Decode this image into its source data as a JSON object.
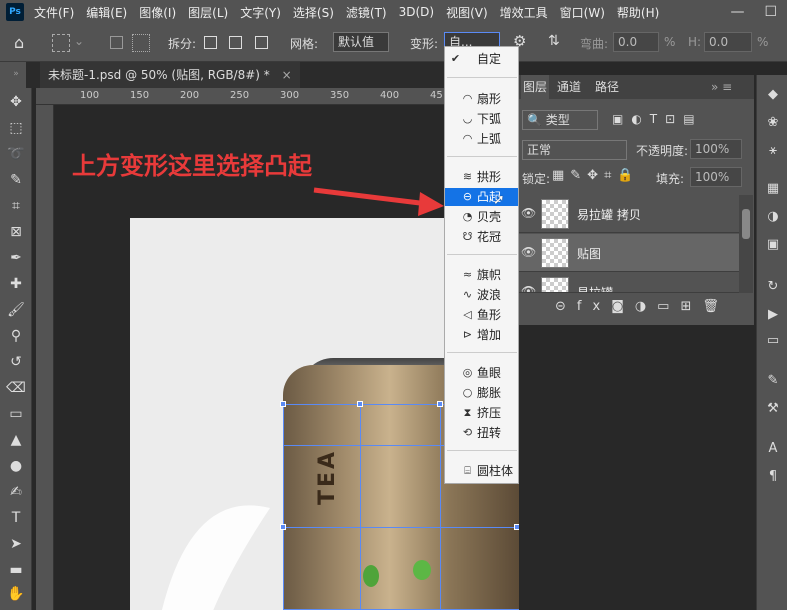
{
  "menubar": {
    "logo": "Ps",
    "items": [
      "文件(F)",
      "编辑(E)",
      "图像(I)",
      "图层(L)",
      "文字(Y)",
      "选择(S)",
      "滤镜(T)",
      "3D(D)",
      "视图(V)",
      "增效工具",
      "窗口(W)",
      "帮助(H)"
    ],
    "window_controls": [
      "—",
      "☐"
    ]
  },
  "options": {
    "split_label": "拆分:",
    "grid_label": "网格:",
    "grid_value": "默认值",
    "warp_label": "变形:",
    "warp_value": "自...",
    "bend_label": "弯曲:",
    "bend_value": "0.0",
    "bend_unit": "%",
    "h_label": "H:",
    "h_value": "0.0",
    "h_unit": "%"
  },
  "document": {
    "tab_title": "未标题-1.psd @ 50% (贴图, RGB/8#) *",
    "tab_close": "×",
    "ruler_marks": [
      "100",
      "150",
      "200",
      "250",
      "300",
      "350",
      "400",
      "45"
    ],
    "can_text": "TEA"
  },
  "warp_menu": {
    "items": [
      {
        "label": "自定",
        "glyph": "✔",
        "checked": true
      },
      {
        "label": "扇形",
        "glyph": "◠"
      },
      {
        "label": "下弧",
        "glyph": "◡"
      },
      {
        "label": "上弧",
        "glyph": "◠"
      },
      {
        "label": "拱形",
        "glyph": "≋"
      },
      {
        "label": "凸起",
        "glyph": "⊖",
        "selected": true
      },
      {
        "label": "贝壳",
        "glyph": "◔"
      },
      {
        "label": "花冠",
        "glyph": "☋"
      },
      {
        "label": "旗帜",
        "glyph": "≈"
      },
      {
        "label": "波浪",
        "glyph": "∿"
      },
      {
        "label": "鱼形",
        "glyph": "◁"
      },
      {
        "label": "增加",
        "glyph": "⊳"
      },
      {
        "label": "鱼眼",
        "glyph": "◎"
      },
      {
        "label": "膨胀",
        "glyph": "○"
      },
      {
        "label": "挤压",
        "glyph": "⧗"
      },
      {
        "label": "扭转",
        "glyph": "⟲"
      },
      {
        "label": "圆柱体",
        "glyph": "⌸"
      }
    ]
  },
  "annotation": {
    "text": "上方变形这里选择凸起",
    "color": "#e83a3a"
  },
  "layers_panel": {
    "tabs": [
      "图层",
      "通道",
      "路径"
    ],
    "filter_value": "类型",
    "blend_mode": "正常",
    "opacity_label": "不透明度:",
    "opacity_value": "100%",
    "lock_label": "锁定:",
    "fill_label": "填充:",
    "fill_value": "100%",
    "layers": [
      {
        "name": "易拉罐 拷贝"
      },
      {
        "name": "贴图"
      },
      {
        "name": "易拉罐"
      }
    ],
    "footer_icons": [
      "link-icon",
      "fx-icon",
      "mask-icon",
      "adjustment-icon",
      "folder-icon",
      "new-layer-icon",
      "trash-icon"
    ]
  },
  "colors": {
    "accent": "#1473e6",
    "transform_grid": "#5a8af5",
    "annotation": "#e83a3a"
  }
}
